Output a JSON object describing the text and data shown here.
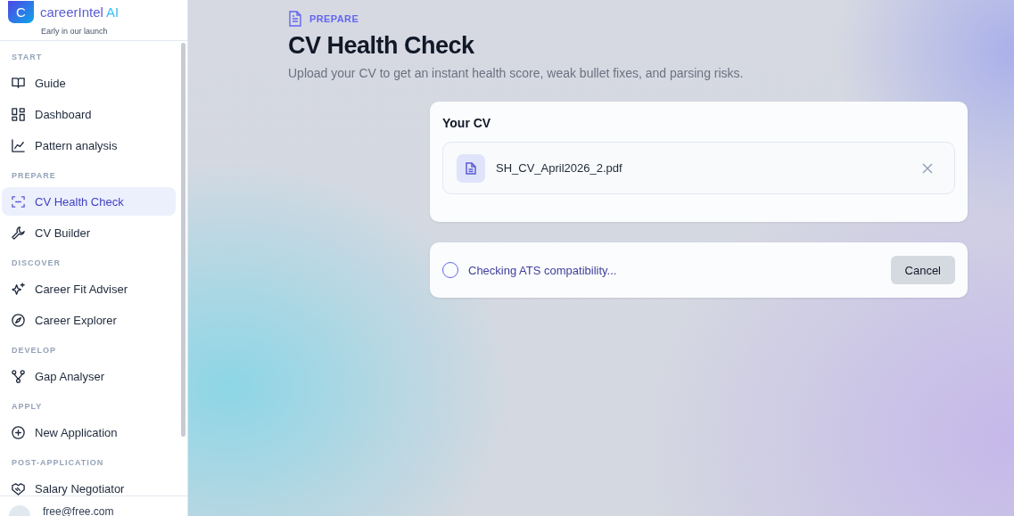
{
  "brand": {
    "logo_letter": "C",
    "name": "careerIntel",
    "name_suffix": "AI",
    "tagline": "Early in our launch"
  },
  "sidebar": {
    "sections": [
      {
        "title": "START",
        "items": [
          {
            "label": "Guide",
            "selected": false
          },
          {
            "label": "Dashboard",
            "selected": false
          },
          {
            "label": "Pattern analysis",
            "selected": false
          }
        ]
      },
      {
        "title": "PREPARE",
        "items": [
          {
            "label": "CV Health Check",
            "selected": true
          },
          {
            "label": "CV Builder",
            "selected": false
          }
        ]
      },
      {
        "title": "DISCOVER",
        "items": [
          {
            "label": "Career Fit Adviser",
            "selected": false
          },
          {
            "label": "Career Explorer",
            "selected": false
          }
        ]
      },
      {
        "title": "DEVELOP",
        "items": [
          {
            "label": "Gap Analyser",
            "selected": false
          }
        ]
      },
      {
        "title": "APPLY",
        "items": [
          {
            "label": "New Application",
            "selected": false
          }
        ]
      },
      {
        "title": "POST-APPLICATION",
        "items": [
          {
            "label": "Salary Negotiator",
            "selected": false
          }
        ]
      }
    ],
    "user": {
      "email": "free@free.com"
    }
  },
  "page": {
    "eyebrow": "PREPARE",
    "title": "CV Health Check",
    "subtitle": "Upload your CV to get an instant health score, weak bullet fixes, and parsing risks."
  },
  "cv_card": {
    "title": "Your CV",
    "file": {
      "name": "SH_CV_April2026_2.pdf"
    }
  },
  "status": {
    "message": "Checking ATS compatibility...",
    "button": "Cancel"
  }
}
